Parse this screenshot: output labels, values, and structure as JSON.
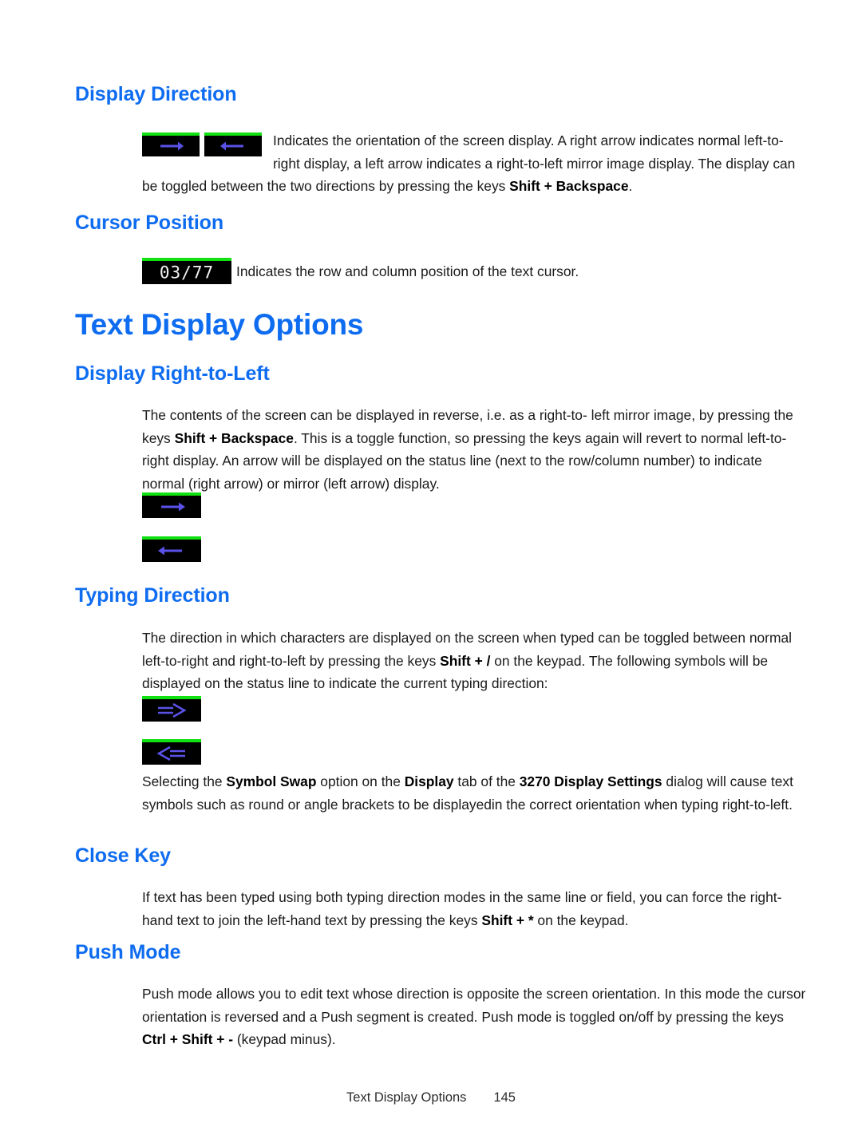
{
  "colors": {
    "heading_blue": "#0e6cf0",
    "status_green": "#11e011",
    "status_black": "#000000",
    "arrow_blue": "#5a52e8",
    "cursor_text": "#f2f2f2"
  },
  "sections": {
    "display_direction": {
      "heading": "Display Direction",
      "paragraph_part1": "Indicates the orientation of the screen display. A right arrow indicates normal left-to-right display, a left arrow indicates a right-to-left mirror image display. The display can be toggled between the two directions by pressing the keys ",
      "paragraph_bold": "Shift + Backspace",
      "paragraph_part2": ".",
      "icons": [
        "right-arrow-status-box",
        "left-arrow-status-box"
      ]
    },
    "cursor_position": {
      "heading": "Cursor Position",
      "indicator_value": "03/77",
      "paragraph": "Indicates the row and column position of the text cursor."
    },
    "text_display_options": {
      "heading": "Text Display Options"
    },
    "display_right_to_left": {
      "heading": "Display Right-to-Left",
      "paragraph_part1": "The contents of the screen can be displayed in reverse, i.e. as a right-to- left mirror image, by pressing the keys ",
      "paragraph_bold": "Shift + Backspace",
      "paragraph_part2": ". This is a toggle function, so pressing the keys again will revert to normal left-to-right display. An arrow will be displayed on the status line (next to the row/column number) to indicate normal (right arrow) or mirror (left arrow) display.",
      "icons": [
        "right-arrow-status-box",
        "left-arrow-status-box"
      ]
    },
    "typing_direction": {
      "heading": "Typing Direction",
      "paragraph_part1": "The direction in which characters are displayed on the screen when typed can be toggled between normal left-to-right and right-to-left by pressing the keys ",
      "paragraph_bold": "Shift + /",
      "paragraph_part2": " on the keypad. The following symbols will be displayed on the status line to indicate the current typing direction:",
      "icons": [
        "double-right-arrow-status-box",
        "double-left-arrow-status-box"
      ],
      "symbol_swap_part1": "Selecting the ",
      "symbol_swap_bold1": "Symbol Swap",
      "symbol_swap_part2": " option on the ",
      "symbol_swap_bold2": "Display",
      "symbol_swap_part3": " tab of the ",
      "symbol_swap_bold3": "3270 Display Settings",
      "symbol_swap_part4": " dialog will cause text symbols such as round or angle brackets to be displayedin the correct orientation when typing right-to-left."
    },
    "close_key": {
      "heading": "Close Key",
      "paragraph_part1": "If text has been typed using both typing direction modes in the same line or field, you can force the right-hand text to join the left-hand text by pressing the keys ",
      "paragraph_bold": "Shift + *",
      "paragraph_part2": " on the keypad."
    },
    "push_mode": {
      "heading": "Push Mode",
      "paragraph_part1": "Push mode allows you to edit text whose direction is opposite the screen orientation. In this mode the cursor orientation is reversed and a Push segment is created. Push mode is toggled on/off by pressing the keys ",
      "paragraph_bold": "Ctrl + Shift + -",
      "paragraph_part2": " (keypad minus)."
    }
  },
  "footer": {
    "title": "Text Display Options",
    "page_number": "145"
  }
}
